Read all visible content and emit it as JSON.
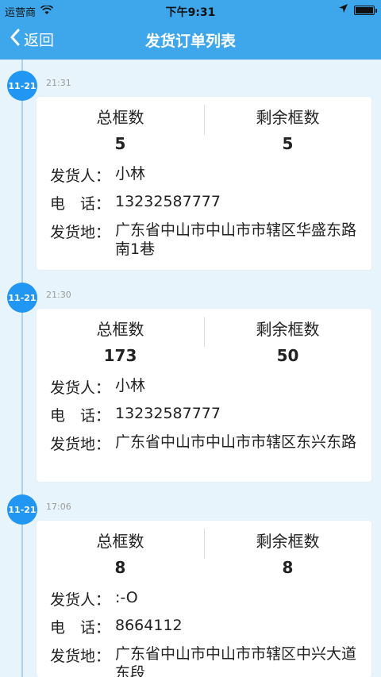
{
  "status": {
    "carrier": "运营商",
    "time": "下午9:31"
  },
  "nav": {
    "back_label": "返回",
    "title": "发货订单列表"
  },
  "labels": {
    "total": "总框数",
    "remaining": "剩余框数",
    "shipper": "发货人：",
    "phone": "电　话：",
    "origin": "发货地："
  },
  "orders": [
    {
      "date": "11-21",
      "time": "21:31",
      "total": "5",
      "remaining": "5",
      "shipper": "小林",
      "phone": "13232587777",
      "origin": "广东省中山市中山市市辖区华盛东路南1巷"
    },
    {
      "date": "11-21",
      "time": "21:30",
      "total": "173",
      "remaining": "50",
      "shipper": "小林",
      "phone": "13232587777",
      "origin": "广东省中山市中山市市辖区东兴东路"
    },
    {
      "date": "11-21",
      "time": "17:06",
      "total": "8",
      "remaining": "8",
      "shipper": ":-O",
      "phone": "8664112",
      "origin": "广东省中山市中山市市辖区中兴大道东段"
    }
  ]
}
